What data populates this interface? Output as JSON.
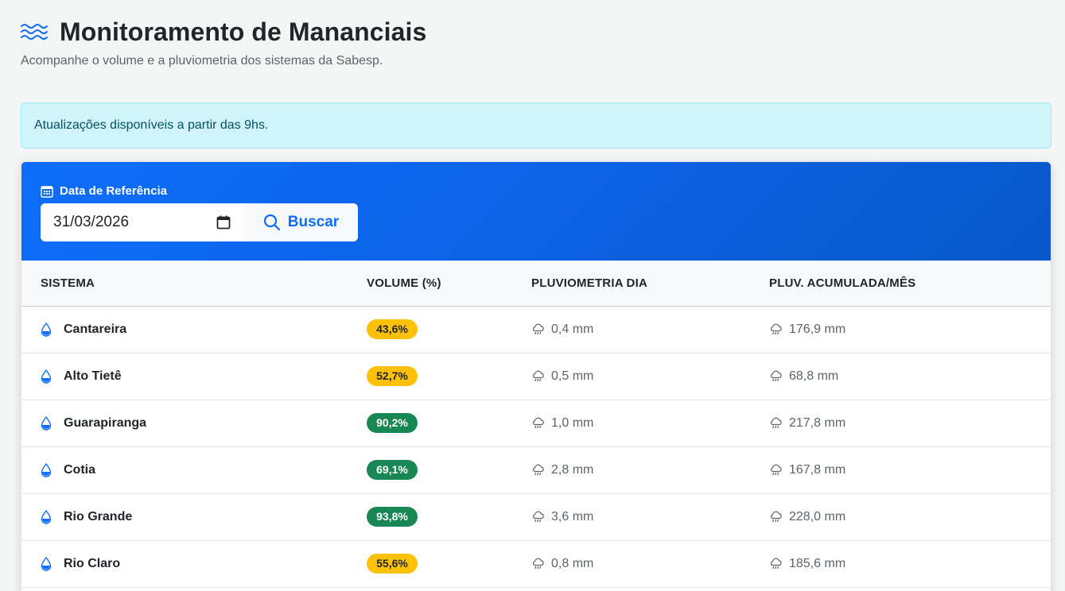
{
  "header": {
    "title": "Monitoramento de Mananciais",
    "subtitle": "Acompanhe o volume e a pluviometria dos sistemas da Sabesp.",
    "icon": "water-waves-icon"
  },
  "alert": {
    "text": "Atualizações disponíveis a partir das 9hs."
  },
  "search": {
    "label": "Data de Referência",
    "date_value": "31/03/2026",
    "button_label": "Buscar"
  },
  "table": {
    "columns": [
      "SISTEMA",
      "VOLUME (%)",
      "PLUVIOMETRIA DIA",
      "PLUV. ACUMULADA/MÊS"
    ],
    "rows": [
      {
        "sistema": "Cantareira",
        "volume": "43,6%",
        "status": "warning",
        "dia": "0,4 mm",
        "mes": "176,9 mm"
      },
      {
        "sistema": "Alto Tietê",
        "volume": "52,7%",
        "status": "warning",
        "dia": "0,5 mm",
        "mes": "68,8 mm"
      },
      {
        "sistema": "Guarapiranga",
        "volume": "90,2%",
        "status": "success",
        "dia": "1,0 mm",
        "mes": "217,8 mm"
      },
      {
        "sistema": "Cotia",
        "volume": "69,1%",
        "status": "success",
        "dia": "2,8 mm",
        "mes": "167,8 mm"
      },
      {
        "sistema": "Rio Grande",
        "volume": "93,8%",
        "status": "success",
        "dia": "3,6 mm",
        "mes": "228,0 mm"
      },
      {
        "sistema": "Rio Claro",
        "volume": "55,6%",
        "status": "warning",
        "dia": "0,8 mm",
        "mes": "185,6 mm"
      }
    ]
  },
  "colors": {
    "primary": "#0d6efd",
    "warning": "#ffc107",
    "success": "#198754",
    "info_bg": "#cff4fc"
  }
}
